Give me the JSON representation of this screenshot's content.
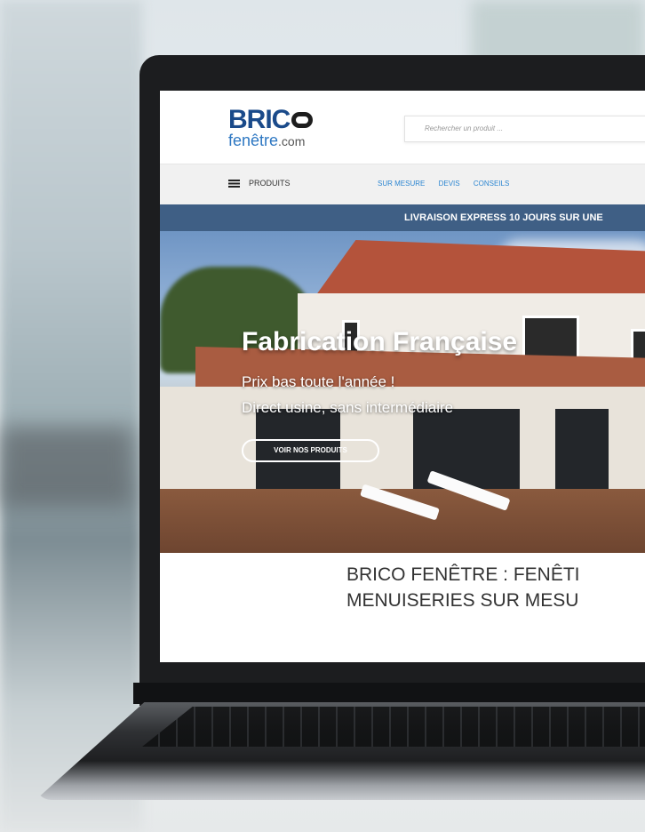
{
  "site": {
    "logo_top": "BRIC",
    "logo_bottom": "fenêtre",
    "logo_domain": ".com",
    "search_placeholder": "Rechercher un produit ...",
    "nav_products": "PRODUITS",
    "nav_links": [
      "SUR MESURE",
      "DEVIS",
      "CONSEILS"
    ],
    "promo": "LIVRAISON EXPRESS 10 JOURS SUR UNE",
    "hero_title": "Fabrication Française",
    "hero_line1": "Prix bas toute l'année !",
    "hero_line2": "Direct usine, sans intermédiaire",
    "hero_button": "VOIR NOS PRODUITS",
    "section_title_line1": "BRICO FENÊTRE : FENÊTI",
    "section_title_line2": "MENUISERIES SUR MESU"
  },
  "colors": {
    "logo_blue": "#1a4a8a",
    "link_blue": "#2c86d1",
    "promo_bg": "#3f5f85"
  }
}
